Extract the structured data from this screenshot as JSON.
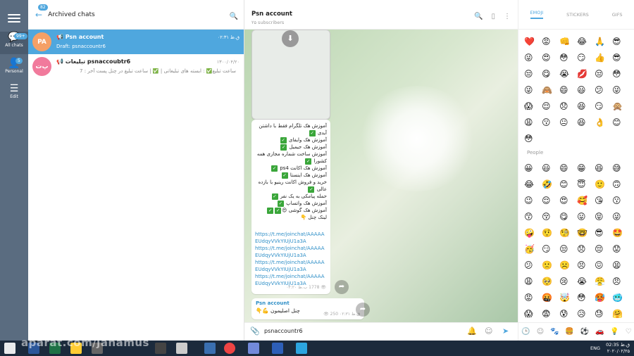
{
  "sidebar": {
    "menu_icon": "hamburger-icon",
    "items": [
      {
        "label": "All chats",
        "badge": "99+",
        "icon": "chat-bubbles-icon"
      },
      {
        "label": "Personal",
        "badge": "5",
        "icon": "person-icon"
      },
      {
        "label": "Edit",
        "icon": "sliders-icon"
      }
    ]
  },
  "chat_list": {
    "header_title": "Archived chats",
    "back_badge": "82",
    "chats": [
      {
        "avatar_initials": "PA",
        "avatar_color": "#f5a066",
        "name": "Psn account",
        "time": "ق.ظ ۰۲:۳۱",
        "preview": "Draft: psnaccountr6",
        "selected": true
      },
      {
        "avatar_initials": "پ‌ت",
        "avatar_color": "#f17a9c",
        "name": "تبلیغات psnaccoubtr6",
        "time": "۱۳۰۰/۰۴/۲۰",
        "preview": "ساعت تبلیغ✅ : ابسته های تبلیغاتی | ✅ | ساعت تبلیغ در چنل پست آخر : 7",
        "selected": false
      }
    ]
  },
  "chat": {
    "title": "Psn account",
    "subtitle": "۲۵ subscribers",
    "post1": {
      "lines": [
        "آموزش هک تلگرام فقط با داشتن آیدی",
        "آموزش هک وایفای",
        "آموزش هک جیمیل",
        "آموزش ساخت شماره مجازی همه کشورا",
        "آموزش هک اکانت ps4",
        "آموزش هک اینستا",
        "خرید و فروش اکانت رینیو با بازده عالی",
        "حمله پیامکی به یک نفر",
        "آموزش هک واتساپ",
        "آموزش هک گوشی",
        "لینک چنل"
      ],
      "links": [
        "https://t.me/joinchat/AAAAAEUdqyVVkYIUjU1a3A",
        "https://t.me/joinchat/AAAAAEUdqyVVkYIUjU1a3A",
        "https://t.me/joinchat/AAAAAEUdqyVVkYIUjU1a3A",
        "https://t.me/joinchat/AAAAAEUdqyVVkYIUjU1a3A"
      ],
      "views": "1778",
      "time": "ب.ظ ۰۲:۲۰"
    },
    "post2": {
      "channel": "Psn account",
      "text": "چنل اصلیمون 💪👇",
      "views": "250",
      "time": "ق.ظ ۰۲:۳۱"
    },
    "compose_value": "psnaccountr6"
  },
  "emoji_panel": {
    "tabs": [
      "EMOJI",
      "STICKERS",
      "GIFS"
    ],
    "active_tab": "EMOJI",
    "section_label": "People",
    "recent": [
      "❤️",
      "😡",
      "👊",
      "😂",
      "🙏",
      "😎",
      "😜",
      "😍",
      "😳",
      "😏",
      "👍",
      "😎",
      "😒",
      "😋",
      "😭",
      "💋",
      "😒",
      "😳",
      "😜",
      "🙈",
      "😄",
      "😃",
      "😕",
      "😜",
      "😱",
      "😌",
      "😞",
      "😆",
      "😏",
      "🙊",
      "😩",
      "😗",
      "😐",
      "😆",
      "👌",
      "😊",
      "😳"
    ],
    "people": [
      "😀",
      "😃",
      "😄",
      "😁",
      "😆",
      "😅",
      "😂",
      "🤣",
      "😊",
      "😇",
      "🙂",
      "🙃",
      "😉",
      "😌",
      "😍",
      "🥰",
      "😘",
      "😗",
      "😙",
      "😚",
      "😋",
      "😛",
      "😝",
      "😜",
      "🤪",
      "🤨",
      "🧐",
      "🤓",
      "😎",
      "🤩",
      "🥳",
      "😏",
      "😒",
      "😞",
      "😔",
      "😟",
      "😕",
      "🙁",
      "☹️",
      "😣",
      "😖",
      "😫",
      "😩",
      "🥺",
      "😢",
      "😭",
      "😤",
      "😠",
      "😡",
      "🤬",
      "🤯",
      "😳",
      "🥵",
      "🥶",
      "😱",
      "😨",
      "😰",
      "😥",
      "😓",
      "🤗"
    ]
  },
  "taskbar": {
    "lang": "ENG",
    "time": "ق.ظ 02:35",
    "date": "۲۰۲۰/۰۲/۲۵",
    "watermark": "aparat.com/janamus"
  }
}
